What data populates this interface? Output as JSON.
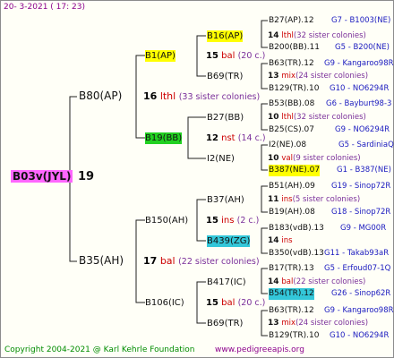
{
  "header": "20-  3-2021  ( 17: 23)",
  "footer_left": "Copyright 2004-2021 @ Karl Kehrle Foundation",
  "footer_right": "www.pedigreeapis.org",
  "root": {
    "name": "B03v(JYL)",
    "gen": "19"
  },
  "g1": [
    {
      "name": "B80(AP)",
      "gen": "16",
      "sub": "lthl",
      "col": "(33 sister colonies)"
    },
    {
      "name": "B35(AH)",
      "gen": "17",
      "sub": "bal",
      "col": "(22 sister colonies)"
    }
  ],
  "g2": [
    {
      "name": "B1(AP)",
      "gen": "15",
      "sub": "bal",
      "col": "(20 c.)"
    },
    {
      "name": "B19(BB)",
      "gen": "12",
      "sub": "nst",
      "col": "(14 c.)"
    },
    {
      "name": "B150(AH)",
      "gen": "15",
      "sub": "ins",
      "col": "(2 c.)"
    },
    {
      "name": "B106(IC)",
      "gen": "15",
      "sub": "bal",
      "col": "(20 c.)"
    }
  ],
  "g3": [
    {
      "name": "B16(AP)",
      "gen": "14",
      "sub": "lthl",
      "col": "(32 sister colonies)"
    },
    {
      "name": "B69(TR)",
      "gen": "13",
      "sub": "mix",
      "col": "(24 sister colonies)"
    },
    {
      "name": "B27(BB)",
      "gen": "10",
      "sub": "lthl",
      "col": "(32 sister colonies)"
    },
    {
      "name": "I2(NE)",
      "gen": "10",
      "sub": "val",
      "col": "(9 sister colonies)"
    },
    {
      "name": "B37(AH)",
      "gen": "11",
      "sub": "ins",
      "col": "(5 sister colonies)"
    },
    {
      "name": "B439(ZG)",
      "gen": "14",
      "sub": "ins",
      "col": ""
    },
    {
      "name": "B417(IC)",
      "gen": "14",
      "sub": "bal",
      "col": "(22 sister colonies)"
    },
    {
      "name": "B69(TR)",
      "gen": "13",
      "sub": "mix",
      "col": "(24 sister colonies)"
    }
  ],
  "g4": [
    {
      "left": "B27(AP).12",
      "right": "G7 - B1003(NE)"
    },
    {
      "left": "B200(BB).11",
      "right": "G5 - B200(NE)"
    },
    {
      "left": "B63(TR).12",
      "right": "G9 - Kangaroo98R"
    },
    {
      "left": "B129(TR).10",
      "right": "G10 - NO6294R"
    },
    {
      "left": "B53(BB).08",
      "right": "G6 - Bayburt98-3"
    },
    {
      "left": "B25(CS).07",
      "right": "G9 - NO6294R"
    },
    {
      "left": "I2(NE).08",
      "right": "G5 - SardiniaQ"
    },
    {
      "left": "B387(NE).07",
      "right": "G1 - B387(NE)"
    },
    {
      "left": "B51(AH).09",
      "right": "G19 - Sinop72R"
    },
    {
      "left": "B19(AH).08",
      "right": "G18 - Sinop72R"
    },
    {
      "left": "B183(vdB).13",
      "right": "G9 - MG00R"
    },
    {
      "left": "B350(vdB).13",
      "right": "G11 - Takab93aR"
    },
    {
      "left": "B17(TR).13",
      "right": "G5 - Erfoud07-1Q"
    },
    {
      "left": "B54(TR).12",
      "right": "G26 - Sinop62R"
    },
    {
      "left": "B63(TR).12",
      "right": "G9 - Kangaroo98R"
    },
    {
      "left": "B129(TR).10",
      "right": "G10 - NO6294R"
    }
  ],
  "colors": {
    "highlight_yellow": "#ffff00",
    "highlight_green": "#22d122",
    "highlight_cyan": "#33c7d9",
    "root_highlight": "#ff66ff",
    "subspecies_red": "#cc0000",
    "colony_purple": "#7a2f9a",
    "gen_blue": "#1a1abf"
  }
}
